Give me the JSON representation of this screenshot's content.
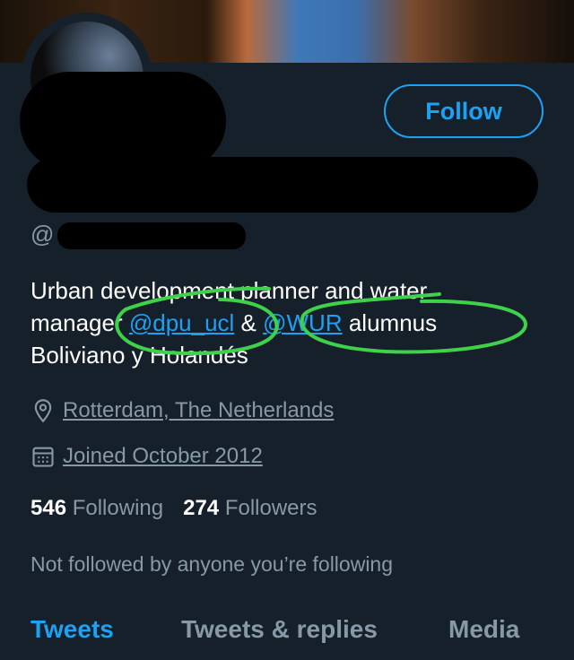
{
  "profile": {
    "handle_prefix": "@",
    "follow_label": "Follow",
    "bio": {
      "line1": "Urban development planner and water",
      "line2_pre": "manager ",
      "mention1": "@dpu_ucl",
      "amp": " & ",
      "mention2": "@WUR",
      "line2_post": " alumnus",
      "line3": "Boliviano y Holandés"
    },
    "location": "Rotterdam, The Netherlands",
    "joined": "Joined October 2012",
    "following_count": "546",
    "following_label": "Following",
    "followers_count": "274",
    "followers_label": "Followers",
    "not_followed": "Not followed by anyone you’re following"
  },
  "tabs": [
    {
      "label": "Tweets",
      "active": true
    },
    {
      "label": "Tweets & replies",
      "active": false
    },
    {
      "label": "Media",
      "active": false
    }
  ],
  "colors": {
    "background": "#15202b",
    "accent": "#1da1f2",
    "secondary_text": "#8899a6",
    "annotation": "#3fd14a"
  },
  "icons": [
    "location-pin-icon",
    "calendar-icon"
  ]
}
